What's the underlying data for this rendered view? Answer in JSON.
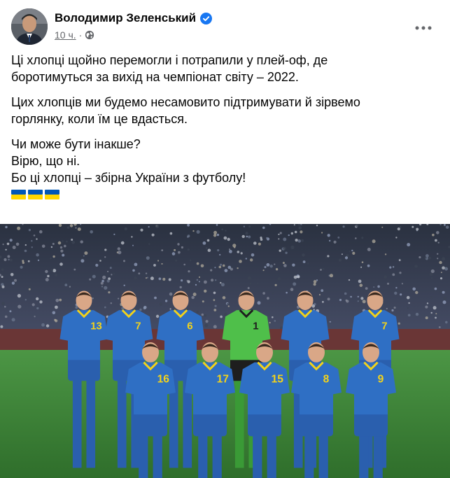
{
  "author": {
    "name": "Володимир Зеленський",
    "verified": true
  },
  "meta": {
    "timestamp": "10 ч.",
    "separator": "·",
    "privacy_icon": "globe-icon"
  },
  "more_icon": "more-dots-icon",
  "post": {
    "paragraphs": [
      {
        "lines": [
          "Ці хлопці щойно перемогли і потрапили у плей-оф, де",
          "боротимуться за вихід на чемпіонат світу – 2022."
        ]
      },
      {
        "lines": [
          "Цих хлопців ми будемо несамовито підтримувати й зірвемо",
          "горлянку, коли їм це вдасться."
        ]
      },
      {
        "lines": [
          "Чи може бути інакше?",
          "Вірю, що ні.",
          "Бо ці хлопці – збірна України з футболу!"
        ]
      }
    ],
    "flags": [
      "ukraine-flag-icon",
      "ukraine-flag-icon",
      "ukraine-flag-icon"
    ]
  },
  "photo": {
    "jersey_numbers_back": [
      "13",
      "7",
      "6",
      "1",
      "7"
    ],
    "jersey_numbers_front": [
      "16",
      "17",
      "15",
      "8",
      "9"
    ]
  },
  "colors": {
    "verified": "#1877f2",
    "secondary_text": "#65676b",
    "flag_blue": "#0057b7",
    "flag_yellow": "#ffd700",
    "kit_blue": "#2f6fc4",
    "kit_yellow": "#f2d21b",
    "keeper_green": "#4fbf4a",
    "pitch": "#3f8a3a"
  }
}
